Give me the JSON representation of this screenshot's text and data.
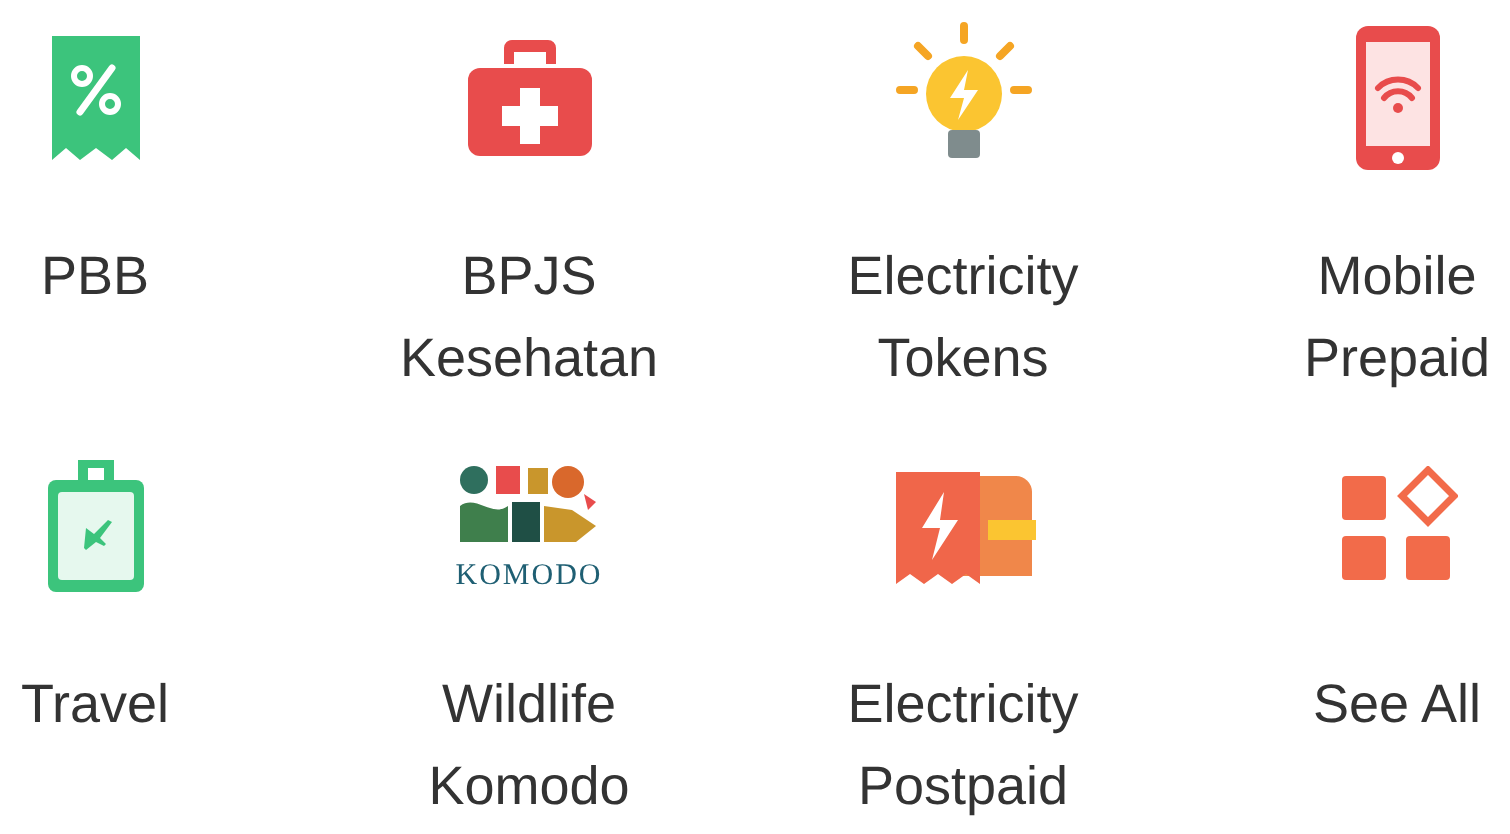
{
  "menu_items": [
    {
      "kind": "tax",
      "label": "PBB"
    },
    {
      "kind": "health",
      "label": "BPJS Kesehatan"
    },
    {
      "kind": "token",
      "label": "Electricity Tokens"
    },
    {
      "kind": "mobile",
      "label": "Mobile Prepaid"
    },
    {
      "kind": "travel",
      "label": "Travel"
    },
    {
      "kind": "komodo",
      "label": "Wildlife Komodo",
      "logo_text": "KOMODO"
    },
    {
      "kind": "postpaid",
      "label": "Electricity Postpaid"
    },
    {
      "kind": "all",
      "label": "See All"
    }
  ]
}
